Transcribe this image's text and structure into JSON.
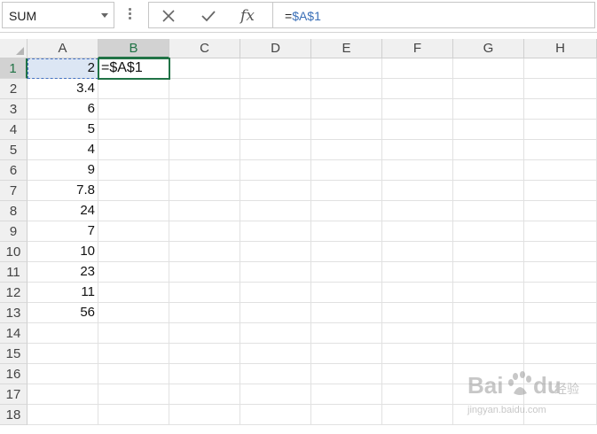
{
  "formula_bar": {
    "name_box": "SUM",
    "cancel_icon": "close-icon",
    "enter_icon": "check-icon",
    "function_icon": "fx-icon",
    "fx_label": "fx",
    "formula_eq": "=",
    "formula_ref": "$A$1"
  },
  "grid": {
    "columns": [
      "A",
      "B",
      "C",
      "D",
      "E",
      "F",
      "G",
      "H"
    ],
    "rows": [
      "1",
      "2",
      "3",
      "4",
      "5",
      "6",
      "7",
      "8",
      "9",
      "10",
      "11",
      "12",
      "13",
      "14",
      "15",
      "16",
      "17",
      "18"
    ],
    "selected_column": "B",
    "selected_row": "1",
    "column_a_values": [
      "2",
      "3.4",
      "6",
      "5",
      "4",
      "9",
      "7.8",
      "24",
      "7",
      "10",
      "23",
      "11",
      "56"
    ],
    "active_cell": {
      "address": "B1",
      "content": "=$A$1"
    },
    "referenced_cell": "A1"
  },
  "watermark": {
    "brand": "Baidu",
    "sub": "经验",
    "url": "jingyan.baidu.com"
  },
  "colors": {
    "accent_green": "#217346",
    "reference_blue": "#3a6fb7",
    "header_bg": "#f0f0f0",
    "gridline": "#e1e1e1"
  }
}
